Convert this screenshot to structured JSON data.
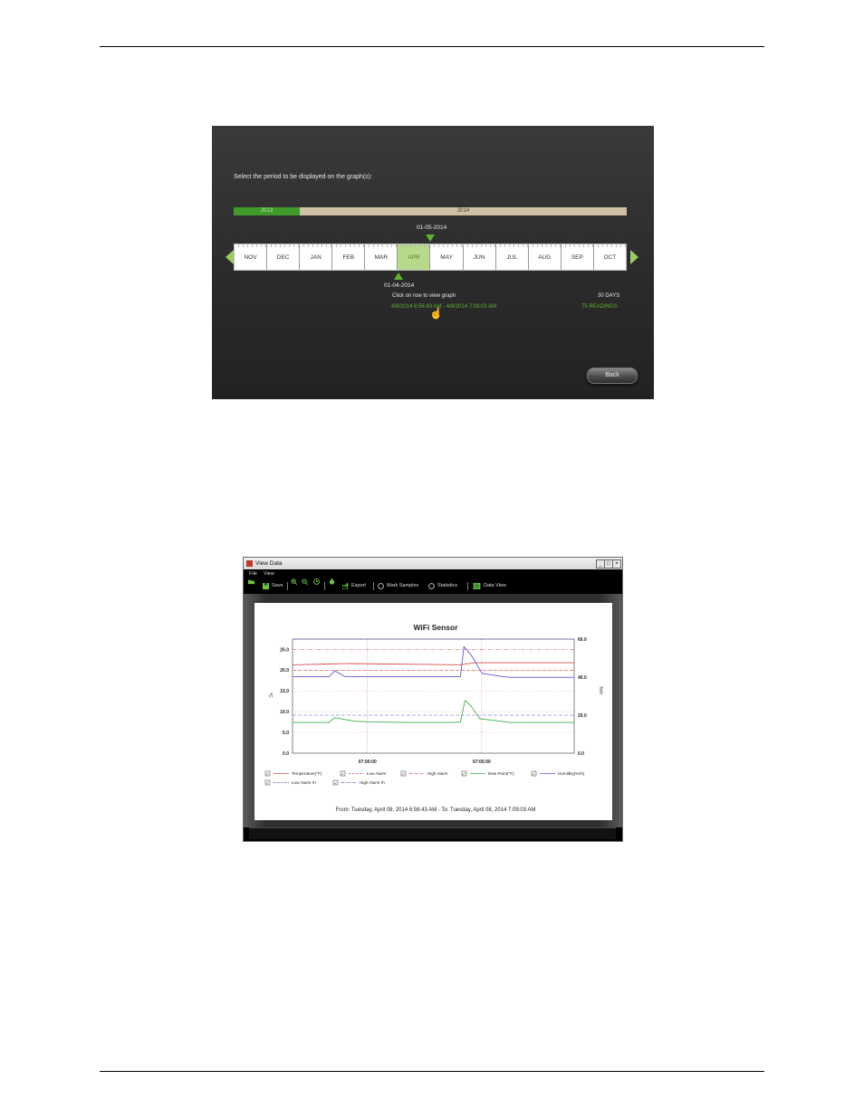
{
  "period_selector": {
    "prompt": "Select the period to be displayed on the graph(s):",
    "years": [
      "2013",
      "2014"
    ],
    "months": [
      "NOV",
      "DEC",
      "JAN",
      "FEB",
      "MAR",
      "APR",
      "MAY",
      "JUN",
      "JUL",
      "AUG",
      "SEP",
      "OCT"
    ],
    "selected_month": "APR",
    "end_date": "01-05-2014",
    "start_date": "01-04-2014",
    "hint": "Click on row to view graph",
    "days": "30 DAYS",
    "range": "4/8/2014 6:56:43 AM - 4/8/2014 7:09:03 AM",
    "readings": "75 READINGS",
    "back_label": "Back"
  },
  "view_data": {
    "window_title": "View Data",
    "menu": [
      "File",
      "View"
    ],
    "toolbar": {
      "save": "Save",
      "export": "Export",
      "mark_samples": "Mark Samples",
      "statistics": "Statistics",
      "data_view": "Data View"
    },
    "range_text": "From: Tuesday, April 08, 2014 6:56:43 AM  -  To: Tuesday, April 08, 2014 7:09:03 AM"
  },
  "chart_data": {
    "type": "line",
    "title": "WiFi Sensor",
    "ylabel": "°C",
    "y2label": "%rh",
    "ylim": [
      0,
      27.5
    ],
    "y2lim": [
      0,
      60
    ],
    "yticks": [
      "25.0",
      "20.0",
      "15.0",
      "10.0",
      "5.0",
      "0.0"
    ],
    "y2ticks": [
      "60.0",
      "40.0",
      "20.0",
      "0.0"
    ],
    "x_ticks": [
      "07:00:00",
      "07:05:00"
    ],
    "x_tick_minutes": [
      3.28,
      8.28
    ],
    "x_range_minutes": [
      0,
      12.33
    ],
    "grid": true,
    "legend_position": "bottom",
    "series": [
      {
        "name": "Temperature(°F)",
        "axis": "left",
        "color": "#d9534f",
        "style": "solid",
        "x": [
          0,
          1.5,
          2.5,
          4,
          6,
          7.3,
          8,
          9,
          12.33
        ],
        "values": [
          21.3,
          21.5,
          21.6,
          21.5,
          21.4,
          21.3,
          21.8,
          21.8,
          21.8
        ]
      },
      {
        "name": "Low Alarm",
        "axis": "left",
        "color": "#d9534f",
        "style": "dash",
        "x": [
          0,
          12.33
        ],
        "values": [
          20.0,
          20.0
        ]
      },
      {
        "name": "High Alarm",
        "axis": "left",
        "color": "#d9534f",
        "style": "dashdot",
        "x": [
          0,
          12.33
        ],
        "values": [
          25.0,
          25.0
        ]
      },
      {
        "name": "Dew Point(°F)",
        "axis": "left",
        "color": "#3fae49",
        "style": "solid",
        "x": [
          0,
          1.6,
          1.85,
          2.2,
          2.7,
          3.5,
          5,
          7,
          7.35,
          7.55,
          7.8,
          8.2,
          9,
          9.5,
          12.33
        ],
        "values": [
          7.4,
          7.4,
          8.6,
          8.2,
          7.7,
          7.5,
          7.4,
          7.4,
          7.5,
          12.7,
          11.5,
          8.3,
          7.8,
          7.4,
          7.4
        ]
      },
      {
        "name": "Humidity(%rh)",
        "axis": "right",
        "color": "#5b5bd6",
        "style": "solid",
        "x": [
          0,
          1.6,
          1.85,
          2.3,
          3.5,
          7.35,
          7.5,
          7.8,
          8.3,
          9.0,
          9.5,
          12.33
        ],
        "values": [
          40.3,
          40.3,
          43.3,
          40.3,
          40.3,
          40.3,
          56.0,
          52.0,
          42.0,
          40.6,
          39.9,
          39.9
        ]
      },
      {
        "name": "Low Alarm rh",
        "axis": "right",
        "color": "#5b5bd6",
        "style": "dash",
        "x": [
          0,
          12.33
        ],
        "values": [
          20.0,
          20.0
        ]
      },
      {
        "name": "High Alarm rh",
        "axis": "right",
        "color": "#5b5bd6",
        "style": "dashdot",
        "x": [
          0,
          12.33
        ],
        "values": [
          60.0,
          60.0
        ]
      }
    ]
  },
  "colors": {
    "accent_green": "#5fb42e",
    "alarm_red": "#d9534f",
    "humidity_blue": "#5b5bd6",
    "dewpoint_green": "#3fae49"
  }
}
